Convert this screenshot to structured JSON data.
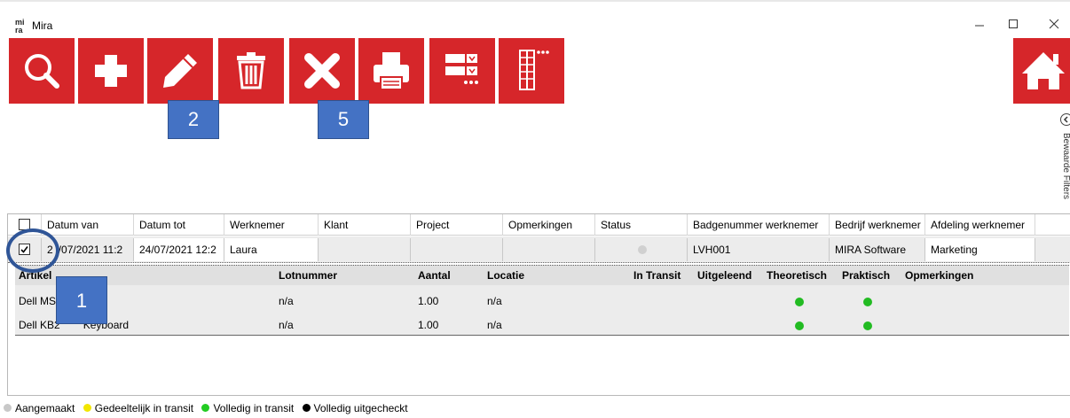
{
  "window": {
    "title": "Mira",
    "logo": "mi ra",
    "minimize_icon": "minimize-icon",
    "maximize_icon": "maximize-icon",
    "close_icon": "close-icon"
  },
  "toolbar": [
    {
      "name": "search-button",
      "icon": "search-icon"
    },
    {
      "name": "add-button",
      "icon": "plus-icon"
    },
    {
      "name": "edit-button",
      "icon": "pencil-icon"
    },
    {
      "name": "delete-button",
      "icon": "trash-icon"
    },
    {
      "name": "cancel-button",
      "icon": "x-icon"
    },
    {
      "name": "print-button",
      "icon": "printer-icon"
    },
    {
      "name": "column-settings-button",
      "icon": "layout-settings-icon"
    },
    {
      "name": "columns-button",
      "icon": "columns-icon"
    },
    {
      "name": "home-button",
      "icon": "home-icon"
    }
  ],
  "annotations": {
    "badge1": "1",
    "badge2": "2",
    "badge5": "5"
  },
  "side_panel": {
    "label": "Bewaarde Filters"
  },
  "grid": {
    "columns": [
      "Datum van",
      "Datum tot",
      "Werknemer",
      "Klant",
      "Project",
      "Opmerkingen",
      "Status",
      "Badgenummer werknemer",
      "Bedrijf werknemer",
      "Afdeling werknemer"
    ],
    "row": {
      "checked": true,
      "datum_van": "24/07/2021 11:2",
      "datum_van_visible": "2",
      "datum_van_tail": "/07/2021 11:2",
      "datum_tot": "24/07/2021 12:2",
      "werknemer": "Laura",
      "klant": "",
      "project": "",
      "opmerkingen": "",
      "status_color": "#d0d0d0",
      "badgenummer": "LVH001",
      "bedrijf": "MIRA Software",
      "afdeling": "Marketing"
    }
  },
  "detail": {
    "columns": [
      "Artikel",
      "Lotnummer",
      "Aantal",
      "Locatie",
      "In Transit",
      "Uitgeleend",
      "Theoretisch",
      "Praktisch",
      "Opmerkingen"
    ],
    "rows": [
      {
        "artikel_visible": "Dell MS",
        "artikel_tail": "e",
        "lotnummer": "n/a",
        "aantal": "1.00",
        "locatie": "n/a",
        "theoretisch_color": "#22bb22",
        "praktisch_color": "#22bb22"
      },
      {
        "artikel_visible": "Dell KB2",
        "artikel_tail": "Keyboard",
        "lotnummer": "n/a",
        "aantal": "1.00",
        "locatie": "n/a",
        "theoretisch_color": "#22bb22",
        "praktisch_color": "#22bb22"
      }
    ]
  },
  "legend": [
    {
      "label": "Aangemaakt",
      "color": "#c8c8c8"
    },
    {
      "label": "Gedeeltelijk in transit",
      "color": "#f2e600"
    },
    {
      "label": "Volledig in transit",
      "color": "#22cc22"
    },
    {
      "label": "Volledig uitgecheckt",
      "color": "#000000"
    }
  ]
}
